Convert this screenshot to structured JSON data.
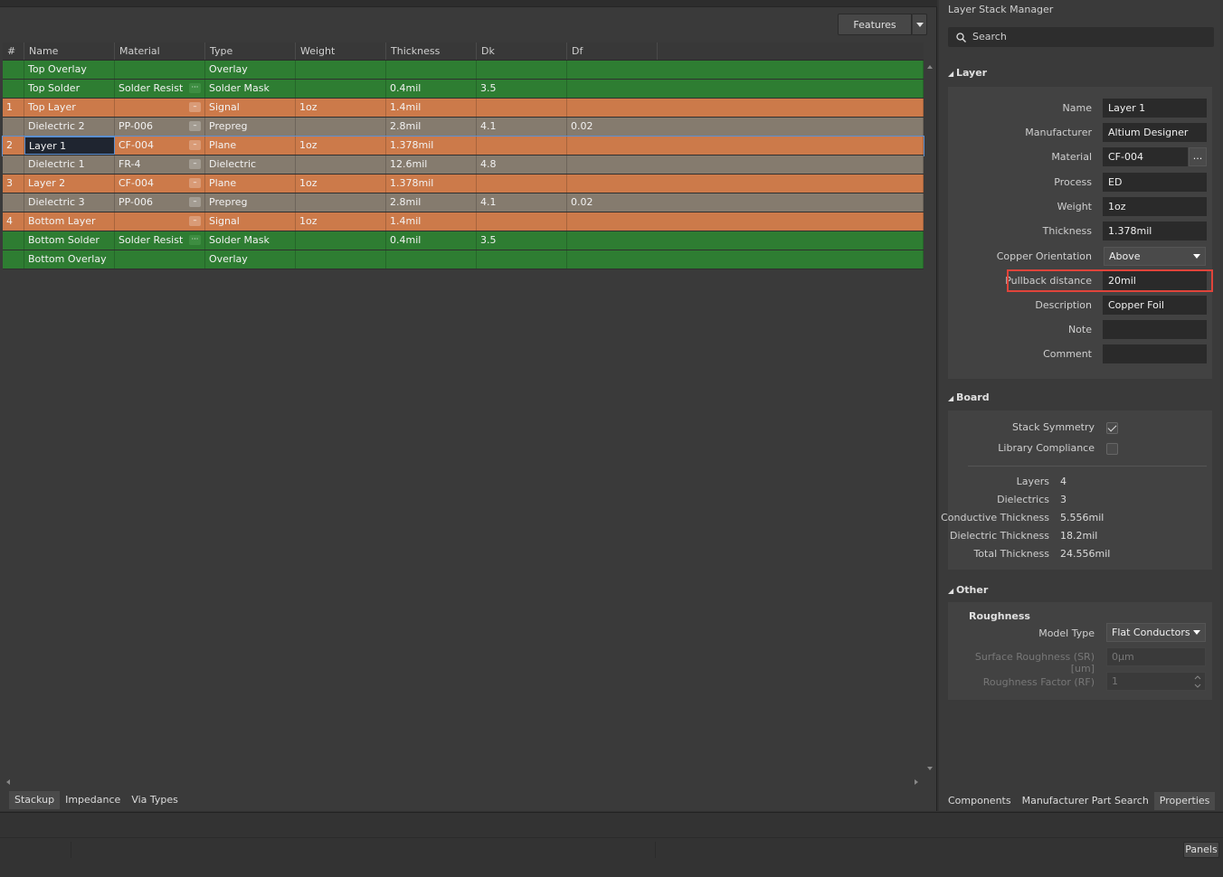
{
  "toolbar": {
    "features_label": "Features"
  },
  "grid": {
    "columns": [
      "#",
      "Name",
      "Material",
      "Type",
      "Weight",
      "Thickness",
      "Dk",
      "Df"
    ],
    "rows": [
      {
        "num": "",
        "name": "Top Overlay",
        "material": "",
        "type": "Overlay",
        "weight": "",
        "thickness": "",
        "dk": "",
        "df": "",
        "style": "green",
        "ell": false
      },
      {
        "num": "",
        "name": "Top Solder",
        "material": "Solder Resist",
        "type": "Solder Mask",
        "weight": "",
        "thickness": "0.4mil",
        "dk": "3.5",
        "df": "",
        "style": "green",
        "ell": true
      },
      {
        "num": "1",
        "name": "Top Layer",
        "material": "",
        "type": "Signal",
        "weight": "1oz",
        "thickness": "1.4mil",
        "dk": "",
        "df": "",
        "style": "orange",
        "ell": true
      },
      {
        "num": "",
        "name": "Dielectric 2",
        "material": "PP-006",
        "type": "Prepreg",
        "weight": "",
        "thickness": "2.8mil",
        "dk": "4.1",
        "df": "0.02",
        "style": "gray",
        "ell": true
      },
      {
        "num": "2",
        "name": "Layer 1",
        "material": "CF-004",
        "type": "Plane",
        "weight": "1oz",
        "thickness": "1.378mil",
        "dk": "",
        "df": "",
        "style": "orange",
        "ell": true,
        "selected": true
      },
      {
        "num": "",
        "name": "Dielectric 1",
        "material": "FR-4",
        "type": "Dielectric",
        "weight": "",
        "thickness": "12.6mil",
        "dk": "4.8",
        "df": "",
        "style": "gray",
        "ell": true
      },
      {
        "num": "3",
        "name": "Layer 2",
        "material": "CF-004",
        "type": "Plane",
        "weight": "1oz",
        "thickness": "1.378mil",
        "dk": "",
        "df": "",
        "style": "orange",
        "ell": true
      },
      {
        "num": "",
        "name": "Dielectric 3",
        "material": "PP-006",
        "type": "Prepreg",
        "weight": "",
        "thickness": "2.8mil",
        "dk": "4.1",
        "df": "0.02",
        "style": "gray",
        "ell": true
      },
      {
        "num": "4",
        "name": "Bottom Layer",
        "material": "",
        "type": "Signal",
        "weight": "1oz",
        "thickness": "1.4mil",
        "dk": "",
        "df": "",
        "style": "orange",
        "ell": true
      },
      {
        "num": "",
        "name": "Bottom Solder",
        "material": "Solder Resist",
        "type": "Solder Mask",
        "weight": "",
        "thickness": "0.4mil",
        "dk": "3.5",
        "df": "",
        "style": "green",
        "ell": true
      },
      {
        "num": "",
        "name": "Bottom Overlay",
        "material": "",
        "type": "Overlay",
        "weight": "",
        "thickness": "",
        "dk": "",
        "df": "",
        "style": "green",
        "ell": false
      }
    ]
  },
  "bottom_tabs": [
    "Stackup",
    "Impedance",
    "Via Types"
  ],
  "panel": {
    "title": "Layer Stack Manager",
    "search_placeholder": "Search",
    "layer_section": {
      "heading": "Layer",
      "name_label": "Name",
      "name_value": "Layer 1",
      "manufacturer_label": "Manufacturer",
      "manufacturer_value": "Altium Designer",
      "material_label": "Material",
      "material_value": "CF-004",
      "material_btn": "...",
      "process_label": "Process",
      "process_value": "ED",
      "weight_label": "Weight",
      "weight_value": "1oz",
      "thickness_label": "Thickness",
      "thickness_value": "1.378mil",
      "orientation_label": "Copper Orientation",
      "orientation_value": "Above",
      "pullback_label": "Pullback distance",
      "pullback_value": "20mil",
      "description_label": "Description",
      "description_value": "Copper Foil",
      "note_label": "Note",
      "note_value": "",
      "comment_label": "Comment",
      "comment_value": ""
    },
    "board_section": {
      "heading": "Board",
      "symmetry_label": "Stack Symmetry",
      "symmetry_checked": true,
      "compliance_label": "Library Compliance",
      "compliance_checked": false,
      "layers_label": "Layers",
      "layers_value": "4",
      "dielectrics_label": "Dielectrics",
      "dielectrics_value": "3",
      "conductive_label": "Conductive Thickness",
      "conductive_value": "5.556mil",
      "dielectric_label": "Dielectric Thickness",
      "dielectric_value": "18.2mil",
      "total_label": "Total Thickness",
      "total_value": "24.556mil"
    },
    "other_section": {
      "heading": "Other",
      "roughness_heading": "Roughness",
      "model_label": "Model Type",
      "model_value": "Flat Conductors",
      "sr_label": "Surface Roughness (SR) [um]",
      "sr_value": "0μm",
      "rf_label": "Roughness Factor (RF)",
      "rf_value": "1"
    },
    "tabs": [
      "Components",
      "Manufacturer Part Search",
      "Properties"
    ]
  },
  "status": {
    "panels_label": "Panels"
  },
  "colors": {
    "signal_orange": "#cc7a4a",
    "dielectric_gray": "#857b6e",
    "mask_green": "#2e7d32",
    "highlight_red": "#e0443a"
  }
}
